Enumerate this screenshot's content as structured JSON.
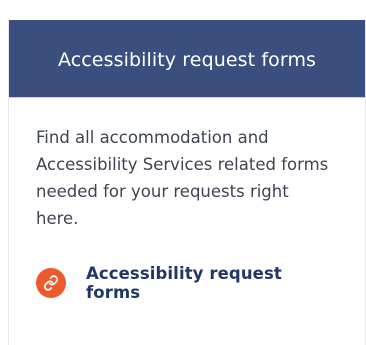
{
  "card": {
    "title": "Accessibility request forms",
    "description": "Find all accommodation and Accessibility Services related forms needed for your requests right here.",
    "link": {
      "label": "Accessibility request forms",
      "icon": "link-icon"
    }
  },
  "colors": {
    "header_background": "#3b4f7f",
    "header_text": "#ffffff",
    "body_text": "#3e4450",
    "link_text": "#233766",
    "icon_background": "#ec5a2e"
  }
}
